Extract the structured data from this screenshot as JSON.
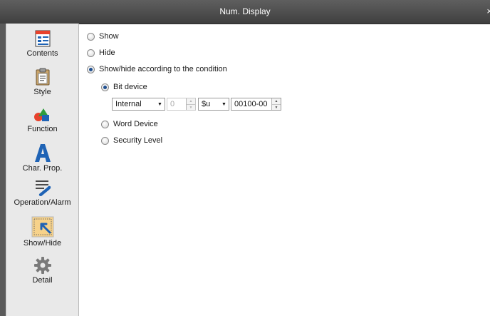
{
  "window": {
    "title": "Num. Display",
    "close_glyph": "×"
  },
  "sidebar": {
    "items": [
      {
        "label": "Contents",
        "icon": "contents-icon"
      },
      {
        "label": "Style",
        "icon": "style-icon"
      },
      {
        "label": "Function",
        "icon": "function-icon"
      },
      {
        "label": "Char. Prop.",
        "icon": "char-prop-icon"
      },
      {
        "label": "Operation/Alarm",
        "icon": "operation-alarm-icon"
      },
      {
        "label": "Show/Hide",
        "icon": "show-hide-icon",
        "selected": true
      },
      {
        "label": "Detail",
        "icon": "gear-icon"
      }
    ]
  },
  "main": {
    "visibility_options": [
      {
        "label": "Show",
        "checked": false
      },
      {
        "label": "Hide",
        "checked": false
      },
      {
        "label": "Show/hide according to the condition",
        "checked": true
      }
    ],
    "condition_options": [
      {
        "label": "Bit device",
        "checked": true
      },
      {
        "label": "Word Device",
        "checked": false
      },
      {
        "label": "Security Level",
        "checked": false
      }
    ],
    "bit_device": {
      "location": "Internal",
      "station_number": "0",
      "device_type": "$u",
      "address": "00100-00"
    }
  },
  "colors": {
    "titlebar": "#4a4a4a",
    "sidebar": "#e9e9e9",
    "selected_item": "#f7d28a",
    "accent_icon_blue": "#1f63b5"
  }
}
